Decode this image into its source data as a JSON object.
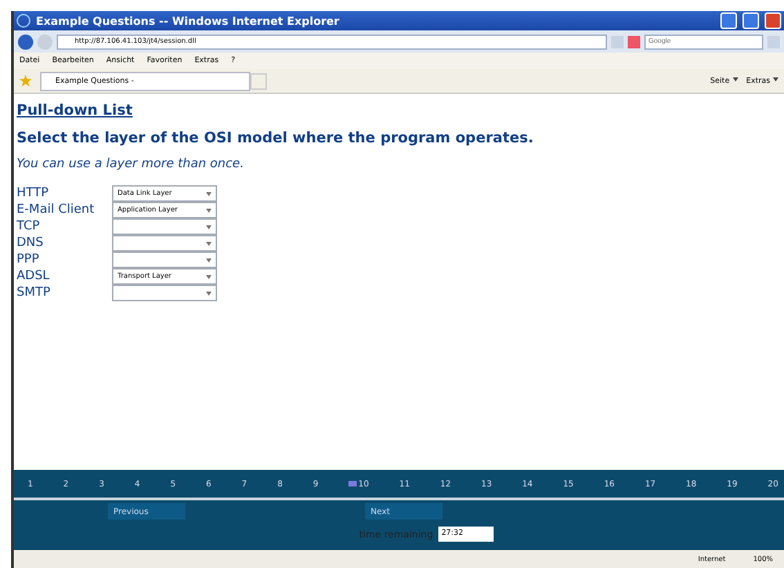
{
  "window": {
    "title": "Example Questions -- Windows Internet Explorer"
  },
  "address_bar": {
    "url": "http://87.106.41.103/jt4/session.dll",
    "search_placeholder": "Google"
  },
  "menu": [
    "Datei",
    "Bearbeiten",
    "Ansicht",
    "Favoriten",
    "Extras",
    "?"
  ],
  "tab": {
    "label": "Example Questions -"
  },
  "toolbar": [
    "Seite",
    "Extras"
  ],
  "page": {
    "heading": "Pull-down List",
    "question": "Select the layer of the OSI model where the program operates.",
    "hint": "You can use a layer more than once.",
    "items": [
      {
        "label": "HTTP",
        "value": "Data Link Layer"
      },
      {
        "label": "E-Mail Client",
        "value": "Application Layer"
      },
      {
        "label": "TCP",
        "value": ""
      },
      {
        "label": "DNS",
        "value": ""
      },
      {
        "label": "PPP",
        "value": ""
      },
      {
        "label": "ADSL",
        "value": "Transport Layer"
      },
      {
        "label": "SMTP",
        "value": ""
      }
    ]
  },
  "question_nav": [
    {
      "label": "1",
      "flagged": false
    },
    {
      "label": "2",
      "flagged": false
    },
    {
      "label": "3",
      "flagged": false
    },
    {
      "label": "4",
      "flagged": false
    },
    {
      "label": "5",
      "flagged": false
    },
    {
      "label": "6",
      "flagged": false
    },
    {
      "label": "7",
      "flagged": false
    },
    {
      "label": "8",
      "flagged": false
    },
    {
      "label": "9",
      "flagged": false
    },
    {
      "label": "10",
      "flagged": true
    },
    {
      "label": "11",
      "flagged": false
    },
    {
      "label": "12",
      "flagged": false
    },
    {
      "label": "13",
      "flagged": false
    },
    {
      "label": "14",
      "flagged": false
    },
    {
      "label": "15",
      "flagged": false
    },
    {
      "label": "16",
      "flagged": false
    },
    {
      "label": "17",
      "flagged": false
    },
    {
      "label": "18",
      "flagged": false
    },
    {
      "label": "19",
      "flagged": false
    },
    {
      "label": "20",
      "flagged": false
    }
  ],
  "buttons": {
    "previous": "Previous",
    "next": "Next"
  },
  "timer": {
    "label": "time remaining",
    "value": "27:32"
  },
  "status_bar": {
    "zone": "Internet",
    "zoom": "100%"
  }
}
